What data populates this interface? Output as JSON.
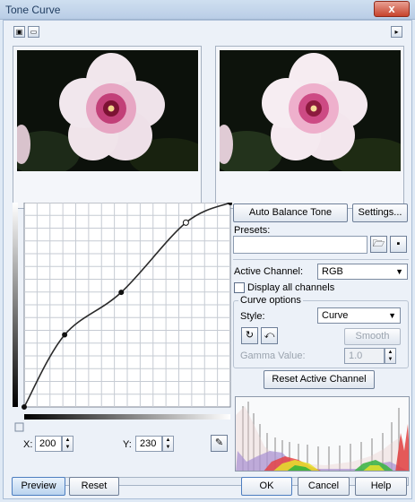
{
  "window": {
    "title": "Tone Curve",
    "close_label": "x"
  },
  "toolbar": {
    "left_icons": [
      "split-view-icon",
      "single-view-icon"
    ],
    "right_icon": "expand-icon"
  },
  "curve_editor": {
    "points": [
      [
        0,
        0
      ],
      [
        50,
        90
      ],
      [
        120,
        143
      ],
      [
        200,
        230
      ],
      [
        255,
        255
      ]
    ],
    "selected_point": [
      200,
      230
    ]
  },
  "buttons": {
    "auto_balance": "Auto Balance Tone",
    "settings": "Settings...",
    "smooth": "Smooth",
    "reset_channel": "Reset Active Channel",
    "preview": "Preview",
    "reset": "Reset",
    "ok": "OK",
    "cancel": "Cancel",
    "help": "Help"
  },
  "presets": {
    "label": "Presets:",
    "value": ""
  },
  "active_channel": {
    "label": "Active Channel:",
    "value": "RGB"
  },
  "display_all": {
    "label": "Display all channels",
    "checked": false
  },
  "curve_options": {
    "group_label": "Curve options",
    "style_label": "Style:",
    "style_value": "Curve",
    "gamma_label": "Gamma Value:",
    "gamma_value": "1.0"
  },
  "coords": {
    "x_label": "X:",
    "x_value": "200",
    "y_label": "Y:",
    "y_value": "230"
  },
  "colors": {
    "dialog_bg": "#ecf1f8",
    "accent": "#4d7ec0",
    "close": "#c7432c"
  }
}
